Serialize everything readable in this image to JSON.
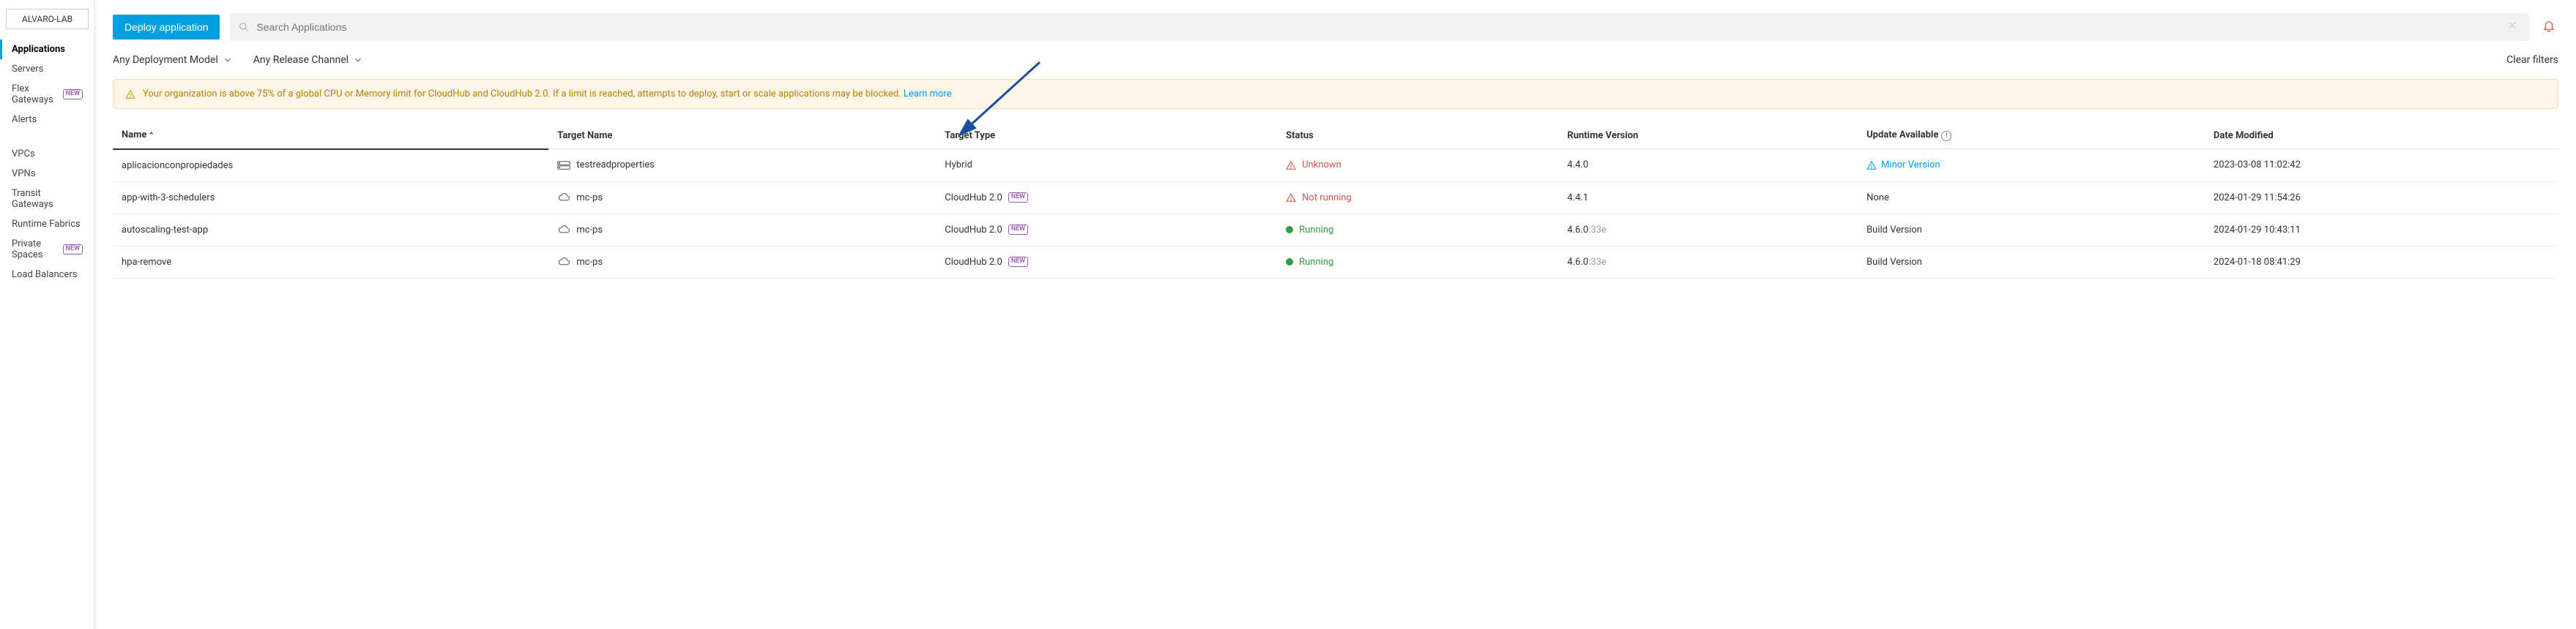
{
  "org": "ALVARO-LAB",
  "sidebar": {
    "group1": [
      {
        "label": "Applications",
        "active": true
      },
      {
        "label": "Servers"
      },
      {
        "label": "Flex Gateways",
        "badge": "NEW"
      },
      {
        "label": "Alerts"
      }
    ],
    "group2": [
      {
        "label": "VPCs"
      },
      {
        "label": "VPNs"
      },
      {
        "label": "Transit Gateways"
      },
      {
        "label": "Runtime Fabrics"
      },
      {
        "label": "Private Spaces",
        "badge": "NEW"
      },
      {
        "label": "Load Balancers"
      }
    ]
  },
  "toolbar": {
    "deploy_label": "Deploy application",
    "search_placeholder": "Search Applications"
  },
  "filters": {
    "deployment_model": "Any Deployment Model",
    "release_channel": "Any Release Channel",
    "clear": "Clear filters"
  },
  "alert": {
    "text": "Your organization is above 75% of a global CPU or Memory limit for CloudHub and CloudHub 2.0. If a limit is reached, attempts to deploy, start or scale applications may be blocked.",
    "link": "Learn more"
  },
  "columns": {
    "name": "Name",
    "target_name": "Target Name",
    "target_type": "Target Type",
    "status": "Status",
    "runtime_version": "Runtime Version",
    "update_available": "Update Available",
    "date_modified": "Date Modified"
  },
  "badges": {
    "new": "NEW"
  },
  "rows": [
    {
      "name": "aplicacionconpropiedades",
      "target_icon": "server",
      "target_name": "testreadproperties",
      "target_type": "Hybrid",
      "target_type_badge": false,
      "status_icon": "warn",
      "status_text": "Unknown",
      "status_class": "status-unknown",
      "runtime": "4.4.0",
      "runtime_suffix": "",
      "update_icon": "warn",
      "update_text": "Minor Version",
      "update_link": true,
      "date": "2023-03-08 11:02:42"
    },
    {
      "name": "app-with-3-schedulers",
      "target_icon": "cloud",
      "target_name": "mc-ps",
      "target_type": "CloudHub 2.0",
      "target_type_badge": true,
      "status_icon": "warn",
      "status_text": "Not running",
      "status_class": "status-notrunning",
      "runtime": "4.4.1",
      "runtime_suffix": "",
      "update_icon": "",
      "update_text": "None",
      "update_link": false,
      "date": "2024-01-29 11:54:26"
    },
    {
      "name": "autoscaling-test-app",
      "target_icon": "cloud",
      "target_name": "mc-ps",
      "target_type": "CloudHub 2.0",
      "target_type_badge": true,
      "status_icon": "dot-green",
      "status_text": "Running",
      "status_class": "status-running",
      "runtime": "4.6.0",
      "runtime_suffix": ":33e",
      "update_icon": "",
      "update_text": "Build Version",
      "update_link": false,
      "date": "2024-01-29 10:43:11"
    },
    {
      "name": "hpa-remove",
      "target_icon": "cloud",
      "target_name": "mc-ps",
      "target_type": "CloudHub 2.0",
      "target_type_badge": true,
      "status_icon": "dot-green",
      "status_text": "Running",
      "status_class": "status-running",
      "runtime": "4.6.0",
      "runtime_suffix": ":33e",
      "update_icon": "",
      "update_text": "Build Version",
      "update_link": false,
      "date": "2024-01-18 08:41:29"
    }
  ]
}
